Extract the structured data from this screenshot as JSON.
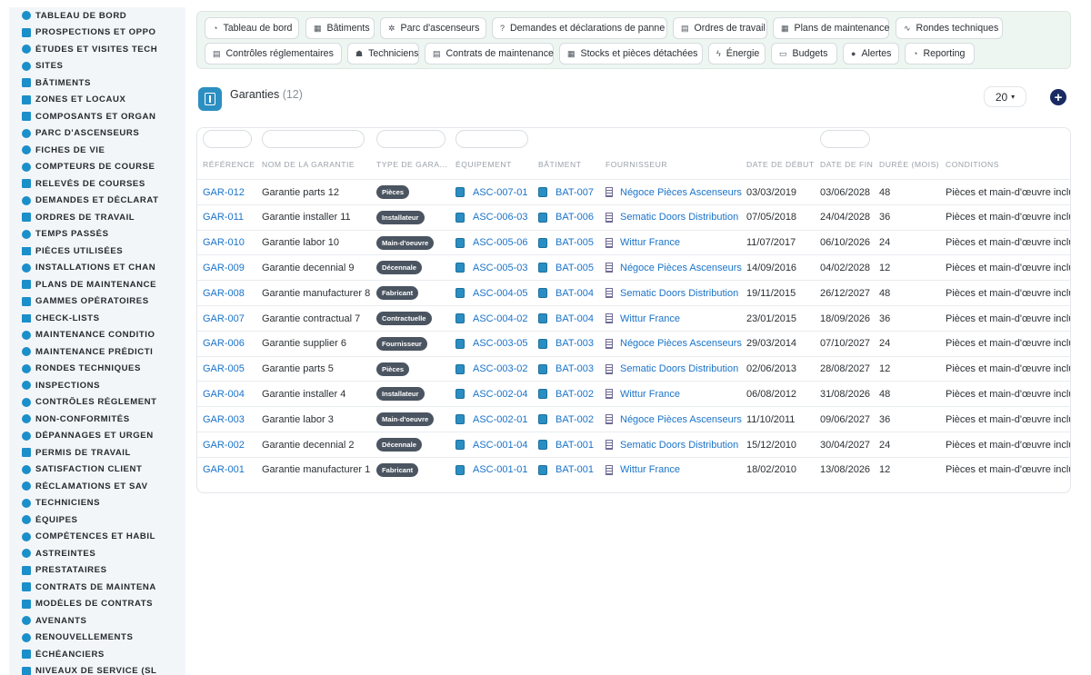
{
  "sidebar": {
    "items": [
      {
        "label": "TABLEAU DE BORD",
        "icon": "dashboard-icon"
      },
      {
        "label": "PROSPECTIONS ET OPPO",
        "icon": "target-icon"
      },
      {
        "label": "ÉTUDES ET VISITES TECH",
        "icon": "clipboard-icon"
      },
      {
        "label": "SITES",
        "icon": "pin-icon"
      },
      {
        "label": "BÂTIMENTS",
        "icon": "building-icon"
      },
      {
        "label": "ZONES ET LOCAUX",
        "icon": "area-icon"
      },
      {
        "label": "COMPOSANTS ET ORGAN",
        "icon": "hierarchy-icon"
      },
      {
        "label": "PARC D'ASCENSEURS",
        "icon": "elevator-icon"
      },
      {
        "label": "FICHES DE VIE",
        "icon": "history-icon"
      },
      {
        "label": "COMPTEURS DE COURSE",
        "icon": "counter-icon"
      },
      {
        "label": "RELEVÉS DE COURSES",
        "icon": "reading-icon"
      },
      {
        "label": "DEMANDES ET DÉCLARAT",
        "icon": "question-icon"
      },
      {
        "label": "ORDRES DE TRAVAIL",
        "icon": "work-order-icon"
      },
      {
        "label": "TEMPS PASSÉS",
        "icon": "clock-icon"
      },
      {
        "label": "PIÈCES UTILISÉES",
        "icon": "list-icon"
      },
      {
        "label": "INSTALLATIONS ET CHAN",
        "icon": "hammer-icon"
      },
      {
        "label": "PLANS DE MAINTENANCE",
        "icon": "calendar-icon"
      },
      {
        "label": "GAMMES OPÉRATOIRES",
        "icon": "grid-icon"
      },
      {
        "label": "CHECK-LISTS",
        "icon": "checklist-icon"
      },
      {
        "label": "MAINTENANCE CONDITIO",
        "icon": "thermometer-icon"
      },
      {
        "label": "MAINTENANCE PRÉDICTI",
        "icon": "chart-icon"
      },
      {
        "label": "RONDES TECHNIQUES",
        "icon": "route-icon"
      },
      {
        "label": "INSPECTIONS",
        "icon": "search-icon"
      },
      {
        "label": "CONTRÔLES RÉGLEMENT",
        "icon": "check-icon"
      },
      {
        "label": "NON-CONFORMITÉS",
        "icon": "alert-circle-icon"
      },
      {
        "label": "DÉPANNAGES ET URGEN",
        "icon": "warning-icon"
      },
      {
        "label": "PERMIS DE TRAVAIL",
        "icon": "permit-icon"
      },
      {
        "label": "SATISFACTION CLIENT",
        "icon": "smile-icon"
      },
      {
        "label": "RÉCLAMATIONS ET SAV",
        "icon": "chat-icon"
      },
      {
        "label": "TECHNICIENS",
        "icon": "technician-icon"
      },
      {
        "label": "ÉQUIPES",
        "icon": "team-icon"
      },
      {
        "label": "COMPÉTENCES ET HABIL",
        "icon": "badge-icon"
      },
      {
        "label": "ASTREINTES",
        "icon": "phone-icon"
      },
      {
        "label": "PRESTATAIRES",
        "icon": "provider-icon"
      },
      {
        "label": "CONTRATS DE MAINTENA",
        "icon": "contract-icon"
      },
      {
        "label": "MODÈLES DE CONTRATS",
        "icon": "template-icon"
      },
      {
        "label": "AVENANTS",
        "icon": "edit-icon"
      },
      {
        "label": "RENOUVELLEMENTS",
        "icon": "refresh-icon"
      },
      {
        "label": "ÉCHÉANCIERS",
        "icon": "schedule-icon"
      },
      {
        "label": "NIVEAUX DE SERVICE (SL",
        "icon": "sla-icon"
      }
    ]
  },
  "topnav": {
    "items": [
      {
        "label": "Tableau de bord",
        "icon": "dashboard-icon"
      },
      {
        "label": "Bâtiments",
        "icon": "building-icon"
      },
      {
        "label": "Parc d'ascenseurs",
        "icon": "elevator-icon"
      },
      {
        "label": "Demandes et déclarations de panne",
        "icon": "question-icon"
      },
      {
        "label": "Ordres de travail",
        "icon": "work-order-icon"
      },
      {
        "label": "Plans de maintenance",
        "icon": "calendar-icon"
      },
      {
        "label": "Rondes techniques",
        "icon": "route-icon"
      },
      {
        "label": "Contrôles réglementaires",
        "icon": "check-icon"
      },
      {
        "label": "Techniciens",
        "icon": "technician-icon"
      },
      {
        "label": "Contrats de maintenance",
        "icon": "contract-icon"
      },
      {
        "label": "Stocks et pièces détachées",
        "icon": "stock-icon"
      },
      {
        "label": "Énergie",
        "icon": "bolt-icon"
      },
      {
        "label": "Budgets",
        "icon": "money-icon"
      },
      {
        "label": "Alertes",
        "icon": "bell-icon"
      },
      {
        "label": "Reporting",
        "icon": "pie-icon"
      }
    ]
  },
  "page": {
    "title": "Garanties",
    "count": "(12)",
    "page_size": "20",
    "icon": "warranty-icon"
  },
  "table": {
    "columns": [
      "RÉFÉRENCE",
      "NOM DE LA GARANTIE",
      "TYPE DE GARA...",
      "ÉQUIPEMENT",
      "BÂTIMENT",
      "FOURNISSEUR",
      "DATE DE DÉBUT",
      "DATE DE FIN",
      "DURÉE (MOIS)",
      "CONDITIONS"
    ],
    "rows": [
      {
        "ref": "GAR-012",
        "name": "Garantie parts 12",
        "type": "Pièces",
        "equipment": "ASC-007-01",
        "building": "BAT-007",
        "supplier": "Négoce Pièces Ascenseurs",
        "start": "03/03/2019",
        "end": "03/06/2028",
        "duration": "48",
        "conditions": "Pièces et main-d'œuvre inclu..."
      },
      {
        "ref": "GAR-011",
        "name": "Garantie installer 11",
        "type": "Installateur",
        "equipment": "ASC-006-03",
        "building": "BAT-006",
        "supplier": "Sematic Doors Distribution",
        "start": "07/05/2018",
        "end": "24/04/2028",
        "duration": "36",
        "conditions": "Pièces et main-d'œuvre inclu..."
      },
      {
        "ref": "GAR-010",
        "name": "Garantie labor 10",
        "type": "Main-d'oeuvre",
        "equipment": "ASC-005-06",
        "building": "BAT-005",
        "supplier": "Wittur France",
        "start": "11/07/2017",
        "end": "06/10/2026",
        "duration": "24",
        "conditions": "Pièces et main-d'œuvre inclu..."
      },
      {
        "ref": "GAR-009",
        "name": "Garantie decennial 9",
        "type": "Décennale",
        "equipment": "ASC-005-03",
        "building": "BAT-005",
        "supplier": "Négoce Pièces Ascenseurs",
        "start": "14/09/2016",
        "end": "04/02/2028",
        "duration": "12",
        "conditions": "Pièces et main-d'œuvre inclu..."
      },
      {
        "ref": "GAR-008",
        "name": "Garantie manufacturer 8",
        "type": "Fabricant",
        "equipment": "ASC-004-05",
        "building": "BAT-004",
        "supplier": "Sematic Doors Distribution",
        "start": "19/11/2015",
        "end": "26/12/2027",
        "duration": "48",
        "conditions": "Pièces et main-d'œuvre inclu..."
      },
      {
        "ref": "GAR-007",
        "name": "Garantie contractual 7",
        "type": "Contractuelle",
        "equipment": "ASC-004-02",
        "building": "BAT-004",
        "supplier": "Wittur France",
        "start": "23/01/2015",
        "end": "18/09/2026",
        "duration": "36",
        "conditions": "Pièces et main-d'œuvre inclu..."
      },
      {
        "ref": "GAR-006",
        "name": "Garantie supplier 6",
        "type": "Fournisseur",
        "equipment": "ASC-003-05",
        "building": "BAT-003",
        "supplier": "Négoce Pièces Ascenseurs",
        "start": "29/03/2014",
        "end": "07/10/2027",
        "duration": "24",
        "conditions": "Pièces et main-d'œuvre inclu..."
      },
      {
        "ref": "GAR-005",
        "name": "Garantie parts 5",
        "type": "Pièces",
        "equipment": "ASC-003-02",
        "building": "BAT-003",
        "supplier": "Sematic Doors Distribution",
        "start": "02/06/2013",
        "end": "28/08/2027",
        "duration": "12",
        "conditions": "Pièces et main-d'œuvre inclu..."
      },
      {
        "ref": "GAR-004",
        "name": "Garantie installer 4",
        "type": "Installateur",
        "equipment": "ASC-002-04",
        "building": "BAT-002",
        "supplier": "Wittur France",
        "start": "06/08/2012",
        "end": "31/08/2026",
        "duration": "48",
        "conditions": "Pièces et main-d'œuvre inclu..."
      },
      {
        "ref": "GAR-003",
        "name": "Garantie labor 3",
        "type": "Main-d'oeuvre",
        "equipment": "ASC-002-01",
        "building": "BAT-002",
        "supplier": "Négoce Pièces Ascenseurs",
        "start": "11/10/2011",
        "end": "09/06/2027",
        "duration": "36",
        "conditions": "Pièces et main-d'œuvre inclu..."
      },
      {
        "ref": "GAR-002",
        "name": "Garantie decennial 2",
        "type": "Décennale",
        "equipment": "ASC-001-04",
        "building": "BAT-001",
        "supplier": "Sematic Doors Distribution",
        "start": "15/12/2010",
        "end": "30/04/2027",
        "duration": "24",
        "conditions": "Pièces et main-d'œuvre inclu..."
      },
      {
        "ref": "GAR-001",
        "name": "Garantie manufacturer 1",
        "type": "Fabricant",
        "equipment": "ASC-001-01",
        "building": "BAT-001",
        "supplier": "Wittur France",
        "start": "18/02/2010",
        "end": "13/08/2026",
        "duration": "12",
        "conditions": "Pièces et main-d'œuvre inclu..."
      }
    ]
  },
  "colors": {
    "accent": "#1a73c9",
    "sidebar_icon": "#1b8fc9",
    "badge": "#4b5561",
    "add_button": "#1a2a63",
    "nav_background": "#eef6f1"
  }
}
